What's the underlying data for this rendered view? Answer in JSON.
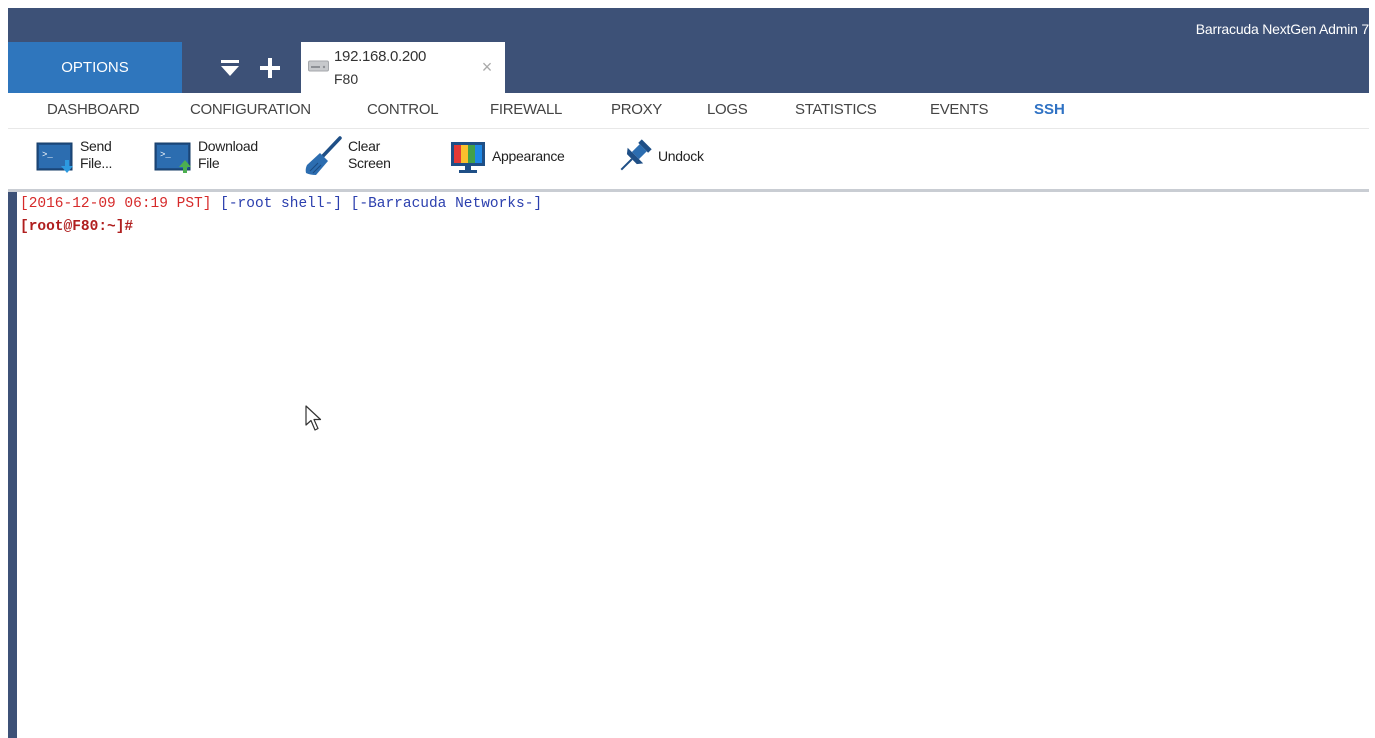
{
  "app": {
    "title": "Barracuda NextGen Admin 7"
  },
  "options": {
    "label": "OPTIONS"
  },
  "tab_controls": {
    "menu_icon": "tab-list-icon",
    "add_icon": "plus-icon"
  },
  "session_tab": {
    "ip": "192.168.0.200",
    "name": "F80",
    "close_glyph": "×",
    "icon": "server-icon"
  },
  "nav": {
    "items": [
      {
        "label": "DASHBOARD",
        "active": false
      },
      {
        "label": "CONFIGURATION",
        "active": false
      },
      {
        "label": "CONTROL",
        "active": false
      },
      {
        "label": "FIREWALL",
        "active": false
      },
      {
        "label": "PROXY",
        "active": false
      },
      {
        "label": "LOGS",
        "active": false
      },
      {
        "label": "STATISTICS",
        "active": false
      },
      {
        "label": "EVENTS",
        "active": false
      },
      {
        "label": "SSH",
        "active": true
      }
    ]
  },
  "toolbar": {
    "send_file": {
      "line1": "Send",
      "line2": "File...",
      "icon": "terminal-upload-icon"
    },
    "download_file": {
      "line1": "Download",
      "line2": "File",
      "icon": "terminal-download-icon"
    },
    "clear_screen": {
      "line1": "Clear",
      "line2": "Screen",
      "icon": "broom-icon"
    },
    "appearance": {
      "label": "Appearance",
      "icon": "monitor-colors-icon"
    },
    "undock": {
      "label": "Undock",
      "icon": "pin-icon"
    }
  },
  "terminal": {
    "line1": {
      "timestamp": "[2016-12-09 06:19 PST]",
      "shell": "[-root shell-]",
      "vendor": "[-Barracuda Networks-]"
    },
    "line2": {
      "prompt": "[root@F80:~]#"
    }
  },
  "colors": {
    "titlebar": "#3d5177",
    "options_button": "#2f76bd",
    "active_nav": "#2f72c4",
    "terminal_red": "#d62a2a",
    "terminal_blue": "#2b3fae"
  }
}
